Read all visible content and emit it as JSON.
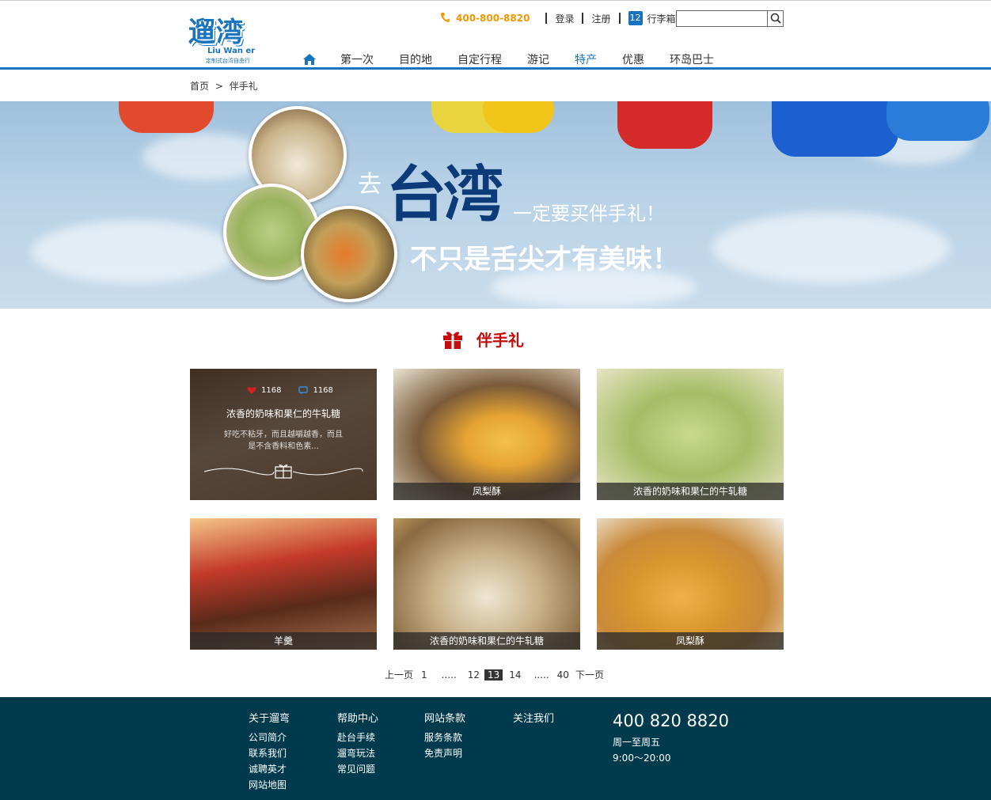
{
  "header": {
    "logo_main": "遛湾",
    "logo_en": "Liu Wan er",
    "logo_sub": "定制式台湾自由行",
    "phone": "400-800-8820",
    "login": "登录",
    "register": "注册",
    "cart_count": "12",
    "cart_label": "行李箱",
    "search_placeholder": ""
  },
  "nav": {
    "items": [
      "第一次",
      "目的地",
      "自定行程",
      "游记",
      "特产",
      "优惠",
      "环岛巴士"
    ],
    "active": "特产"
  },
  "breadcrumb": {
    "home": "首页",
    "sep": ">",
    "current": "伴手礼"
  },
  "banner": {
    "qu": "去",
    "big": "台湾",
    "line1": "一定要买伴手礼！",
    "line2": "不只是舌尖才有美味！"
  },
  "section": {
    "title": "伴手礼"
  },
  "products": [
    {
      "label": "浓香的奶味和果仁的牛轧糖",
      "likes": "1168",
      "comments": "1168",
      "desc": "好吃不粘牙，而且越嚼越香，而且是不含香料和色素..."
    },
    {
      "label": "凤梨酥"
    },
    {
      "label": "浓香的奶味和果仁的牛轧糖"
    },
    {
      "label": "羊羹"
    },
    {
      "label": "浓香的奶味和果仁的牛轧糖"
    },
    {
      "label": "凤梨酥"
    }
  ],
  "pager": {
    "prev": "上一页",
    "first": "1",
    "dots1": ".....",
    "p12": "12",
    "current": "13",
    "p14": "14",
    "dots2": ".....",
    "last": "40",
    "next": "下一页"
  },
  "footer": {
    "col1": {
      "title": "关于遛弯",
      "items": [
        "公司简介",
        "联系我们",
        "诚聘英才",
        "网站地图"
      ]
    },
    "col2": {
      "title": "帮助中心",
      "items": [
        "赴台手续",
        "遛弯玩法",
        "常见问题"
      ]
    },
    "col3": {
      "title": "网站条款",
      "items": [
        "服务条款",
        "免责声明"
      ]
    },
    "col4": {
      "title": "关注我们"
    },
    "phone": "400 820 8820",
    "days": "周一至周五",
    "hours": "9:00～20:00"
  },
  "colors": {
    "brand_blue": "#1a73bf",
    "orange": "#f39800",
    "red": "#c40c0c",
    "footer_bg": "#003a4d"
  }
}
